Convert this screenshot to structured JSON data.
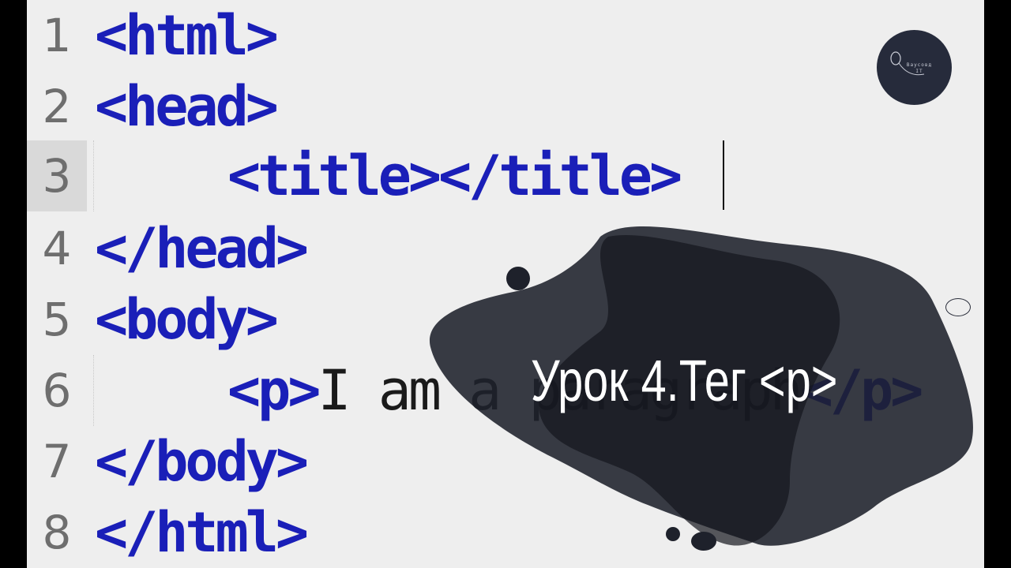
{
  "editor": {
    "lines": [
      {
        "number": "1",
        "code": "<html>"
      },
      {
        "number": "2",
        "code": "<head>"
      },
      {
        "number": "3",
        "code": "<title></title>"
      },
      {
        "number": "4",
        "code": "</head>"
      },
      {
        "number": "5",
        "code": "<body>"
      },
      {
        "number": "6",
        "code_open": "<p>",
        "code_text": "I am a paragraph",
        "code_close": "</p>"
      },
      {
        "number": "7",
        "code": "</body>"
      },
      {
        "number": "8",
        "code": "</html>"
      }
    ],
    "colors": {
      "background": "#eeeeee",
      "tag": "#1a1fb8",
      "line_number": "#6e6e6e",
      "current_line_gutter": "#d9d9d9"
    }
  },
  "logo": {
    "text_line1": "Ваусовд",
    "text_line2": "IT",
    "icon": "mouse-icon",
    "color": "#262b3b"
  },
  "overlay": {
    "headline": "Урок 4.Тег <p>",
    "blob_color": "#1e212b"
  }
}
